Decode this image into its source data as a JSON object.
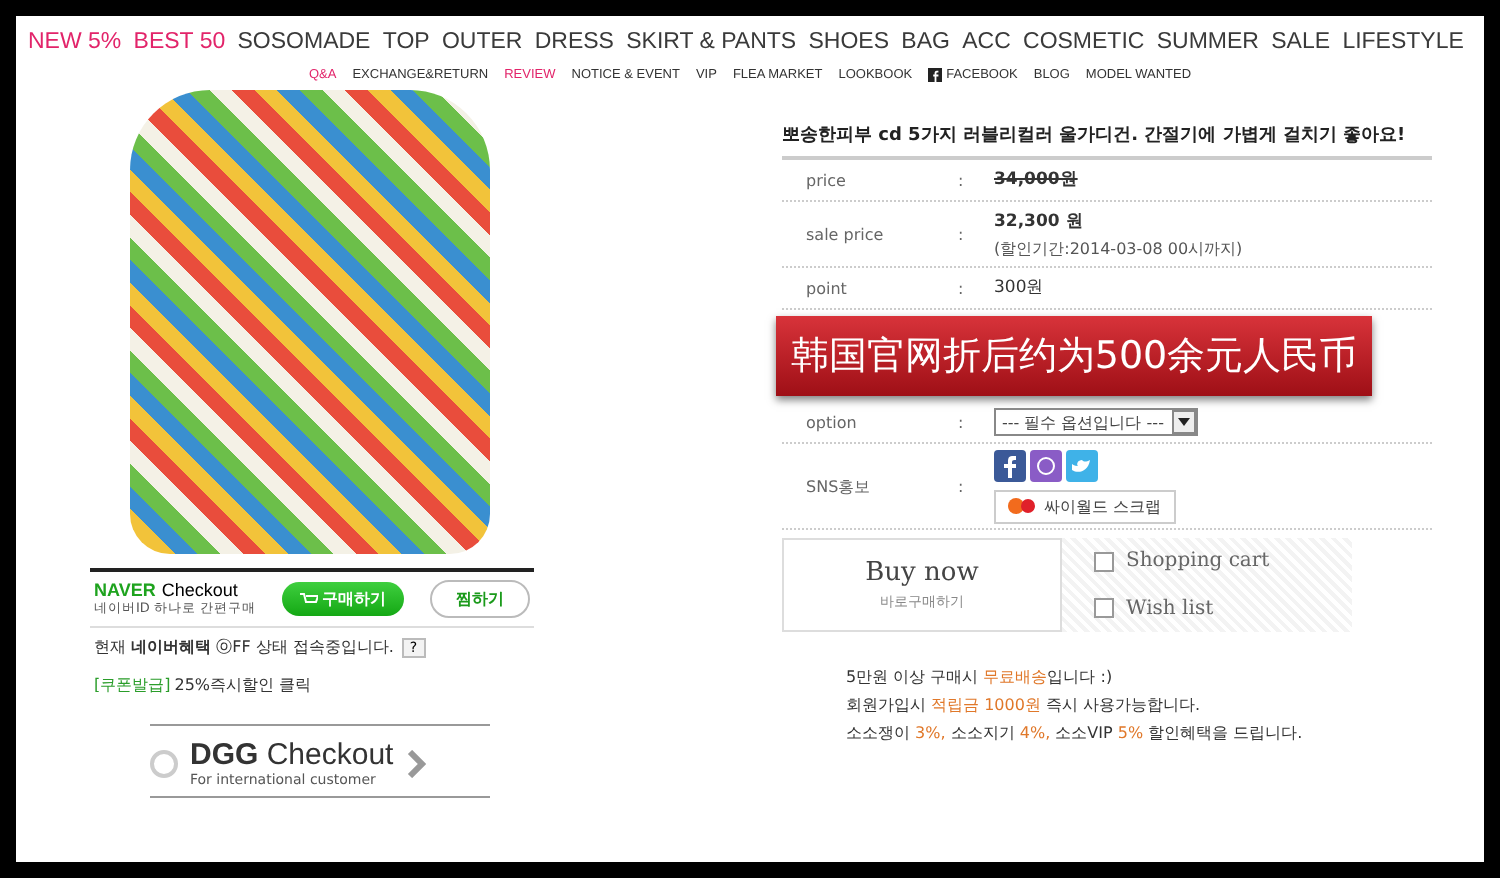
{
  "main_nav": [
    {
      "label": "NEW 5%",
      "highlight": true
    },
    {
      "label": "BEST 50",
      "highlight": true
    },
    {
      "label": "SOSOMADE",
      "highlight": false
    },
    {
      "label": "TOP",
      "highlight": false
    },
    {
      "label": "OUTER",
      "highlight": false
    },
    {
      "label": "DRESS",
      "highlight": false
    },
    {
      "label": "SKIRT & PANTS",
      "highlight": false
    },
    {
      "label": "SHOES",
      "highlight": false
    },
    {
      "label": "BAG",
      "highlight": false
    },
    {
      "label": "ACC",
      "highlight": false
    },
    {
      "label": "COSMETIC",
      "highlight": false
    },
    {
      "label": "SUMMER",
      "highlight": false
    },
    {
      "label": "SALE",
      "highlight": false
    },
    {
      "label": "LIFESTYLE",
      "highlight": false
    }
  ],
  "sub_nav": [
    {
      "label": "Q&A",
      "highlight": true,
      "kind": "text"
    },
    {
      "label": "EXCHANGE&RETURN",
      "highlight": false,
      "kind": "text"
    },
    {
      "label": "REVIEW",
      "highlight": true,
      "kind": "text"
    },
    {
      "label": "NOTICE & EVENT",
      "highlight": false,
      "kind": "text"
    },
    {
      "label": "VIP",
      "highlight": false,
      "kind": "text"
    },
    {
      "label": "FLEA MARKET",
      "highlight": false,
      "kind": "text"
    },
    {
      "label": "LOOKBOOK",
      "highlight": false,
      "kind": "text"
    },
    {
      "label": "FACEBOOK",
      "highlight": false,
      "kind": "facebook"
    },
    {
      "label": "BLOG",
      "highlight": false,
      "kind": "text"
    },
    {
      "label": "MODEL WANTED",
      "highlight": false,
      "kind": "text"
    }
  ],
  "naver": {
    "brand": "NAVER",
    "title": "Checkout",
    "subtitle": "네이버ID 하나로 간편구매",
    "buy": "구매하기",
    "wish": "찜하기",
    "status": "현재 **네이버혜택** ⓞFF 상태 접속중입니다.",
    "help": "?",
    "coupon_tag": "[쿠폰발급]",
    "coupon_text": "25%즉시할인 클릭"
  },
  "dgg": {
    "brand": "DGG",
    "title": "Checkout",
    "subtitle": "For international customer"
  },
  "product": {
    "title": "뽀송한피부 cd 5가지 러블리컬러 울가디건. 간절기에 가볍게 걸치기 좋아요!",
    "rows": [
      {
        "kind": "old_price",
        "label": "price",
        "sep": ":",
        "value": "34,000원"
      },
      {
        "kind": "sale",
        "label": "sale price",
        "sep": ":",
        "value": "32,300 원",
        "note": "(할인기간:2014-03-08 00시까지)"
      },
      {
        "kind": "text",
        "label": "point",
        "sep": ":",
        "value": "300원"
      },
      {
        "kind": "banner",
        "value": "韩国官网折后约为500余元人民币"
      },
      {
        "kind": "select",
        "label": "option",
        "sep": ":",
        "value": "--- 필수 옵션입니다 ---"
      },
      {
        "kind": "sns",
        "label": "SNS홍보",
        "sep": ":",
        "value": "싸이월드 스크랩"
      }
    ]
  },
  "buy_now": {
    "title": "Buy now",
    "subtitle": "바로구매하기"
  },
  "actions": [
    {
      "label": "Shopping cart",
      "checked": false
    },
    {
      "label": "Wish list",
      "checked": false
    }
  ],
  "notices": [
    [
      {
        "text": "5만원 이상 구매시 ",
        "accent": false
      },
      {
        "text": "무료배송",
        "accent": true
      },
      {
        "text": "입니다 :)",
        "accent": false
      }
    ],
    [
      {
        "text": "회원가입시 ",
        "accent": false
      },
      {
        "text": "적립금 1000원",
        "accent": true
      },
      {
        "text": " 즉시 사용가능합니다.",
        "accent": false
      }
    ],
    [
      {
        "text": "소소쟁이 ",
        "accent": false
      },
      {
        "text": "3%,",
        "accent": true
      },
      {
        "text": " 소소지기 ",
        "accent": false
      },
      {
        "text": "4%,",
        "accent": true
      },
      {
        "text": " 소소VIP ",
        "accent": false
      },
      {
        "text": "5%",
        "accent": true
      },
      {
        "text": " 할인혜택을 드립니다.",
        "accent": false
      }
    ]
  ]
}
